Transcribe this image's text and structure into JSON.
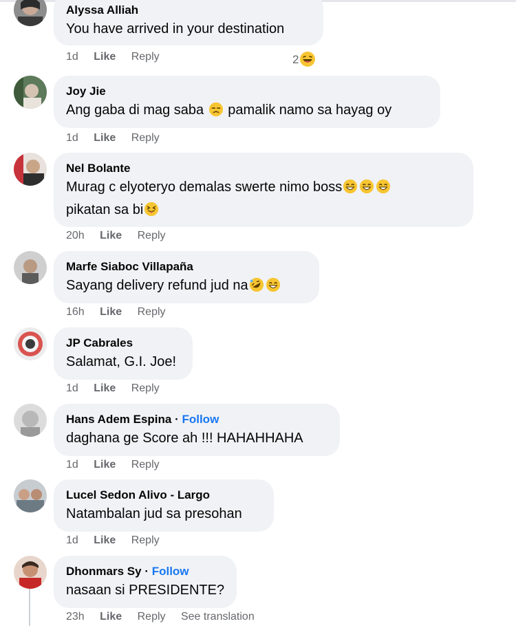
{
  "comments": [
    {
      "author": "Alyssa Alliah",
      "text": "You have arrived in your destination",
      "time": "1d",
      "like": "Like",
      "reply": "Reply",
      "reaction_count": "2"
    },
    {
      "author": "Joy Jie",
      "text_a": "Ang gaba di mag saba",
      "text_b": "pamalik namo sa hayag oy",
      "time": "1d",
      "like": "Like",
      "reply": "Reply"
    },
    {
      "author": "Nel Bolante",
      "line1": "Murag c elyoteryo demalas swerte nimo boss",
      "line2": "pikatan sa bi",
      "time": "20h",
      "like": "Like",
      "reply": "Reply"
    },
    {
      "author": "Marfe Siaboc Villapaña",
      "text": "Sayang delivery refund jud na",
      "time": "16h",
      "like": "Like",
      "reply": "Reply"
    },
    {
      "author": "JP Cabrales",
      "text": "Salamat, G.I. Joe!",
      "time": "1d",
      "like": "Like",
      "reply": "Reply"
    },
    {
      "author": "Hans Adem Espina",
      "follow": "Follow",
      "text": "daghana ge Score ah !!! HAHAHHAHA",
      "time": "1d",
      "like": "Like",
      "reply": "Reply"
    },
    {
      "author": "Lucel Sedon Alivo - Largo",
      "text": "Natambalan jud sa presohan",
      "time": "1d",
      "like": "Like",
      "reply": "Reply"
    },
    {
      "author": "Dhonmars Sy",
      "follow": "Follow",
      "text": "nasaan si PRESIDENTE?",
      "time": "23h",
      "like": "Like",
      "reply": "Reply",
      "see_translation": "See translation"
    }
  ],
  "colors": {
    "bubble": "#f0f2f5",
    "meta": "#65676b",
    "follow": "#1877f2",
    "emoji": "#f7c531"
  },
  "icons": [
    "laughing-emoji",
    "sad-emoji",
    "grin-emoji",
    "squint-tongue-emoji",
    "rofl-emoji",
    "smile-emoji"
  ]
}
